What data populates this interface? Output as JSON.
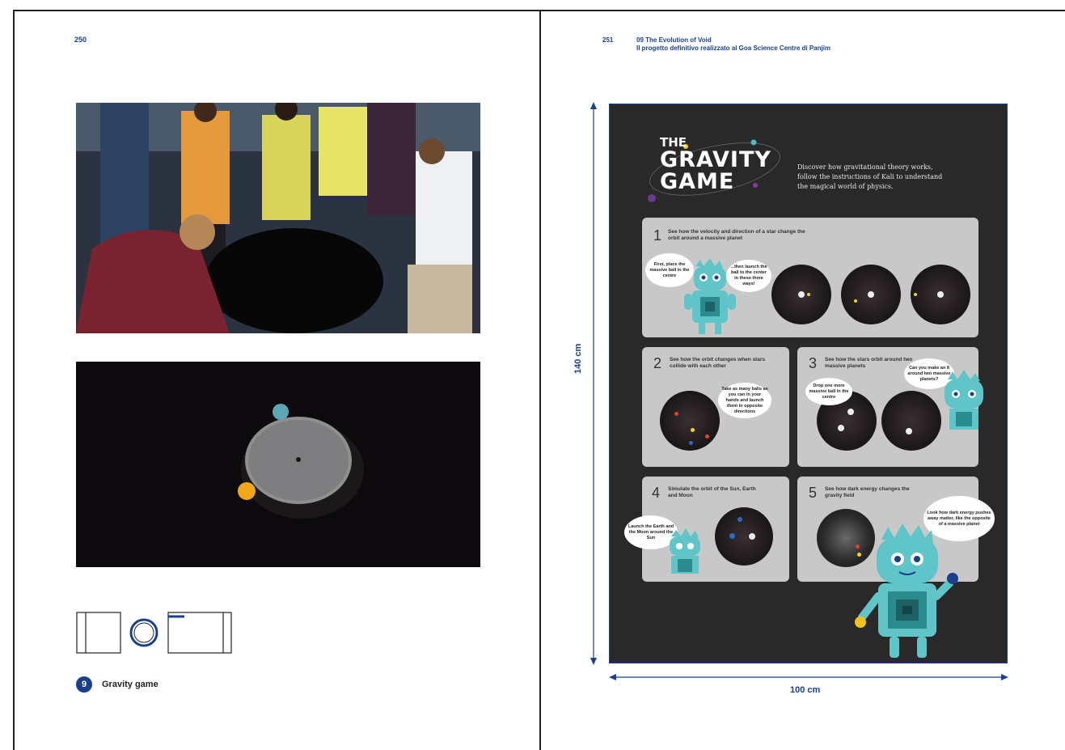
{
  "left_page": {
    "page_number": "250",
    "caption_number": "9",
    "caption": "Gravity game"
  },
  "right_page": {
    "page_number": "251",
    "chapter": "09   The Evolution of Void",
    "subtitle": "Il progetto definitivo realizzato al Goa Science Centre di Panjim",
    "height_label": "140 cm",
    "width_label": "100 cm",
    "poster": {
      "title_line1": "THE",
      "title_line2": "GRAVITY",
      "title_line3": "GAME",
      "intro": "Discover how gravitational theory works, follow the instructions of Kali to understand the magical world of physics.",
      "panels": [
        {
          "num": "1",
          "title": "See how the velocity and direction of a star change the orbit around a massive planet",
          "bubble1": "First, place the massive ball in the centre",
          "bubble2": "...then launch the ball to the center in these three ways!"
        },
        {
          "num": "2",
          "title": "See how the orbit changes when stars collide with each other",
          "bubble1": "Take as many balls as you can in your hands and launch them in opposite directions"
        },
        {
          "num": "3",
          "title": "See how the stars orbit around two massive planets",
          "bubble1": "Drop one more massive ball in the centre",
          "bubble2": "Can you make an 8 around two massive planets?"
        },
        {
          "num": "4",
          "title": "Simulate the orbit of the Sun, Earth and Moon",
          "bubble1": "Launch the Earth and the Moon around the Sun"
        },
        {
          "num": "5",
          "title": "See how dark energy changes the gravity field",
          "bubble1": "Look how dark energy pushes away matter, like the opposite of a massive planet"
        }
      ]
    }
  },
  "colors": {
    "accent": "#1a3f8f",
    "poster_bg": "#2a2929",
    "panel_bg": "#c8c8c9",
    "mascot": "#5fc5c9"
  }
}
